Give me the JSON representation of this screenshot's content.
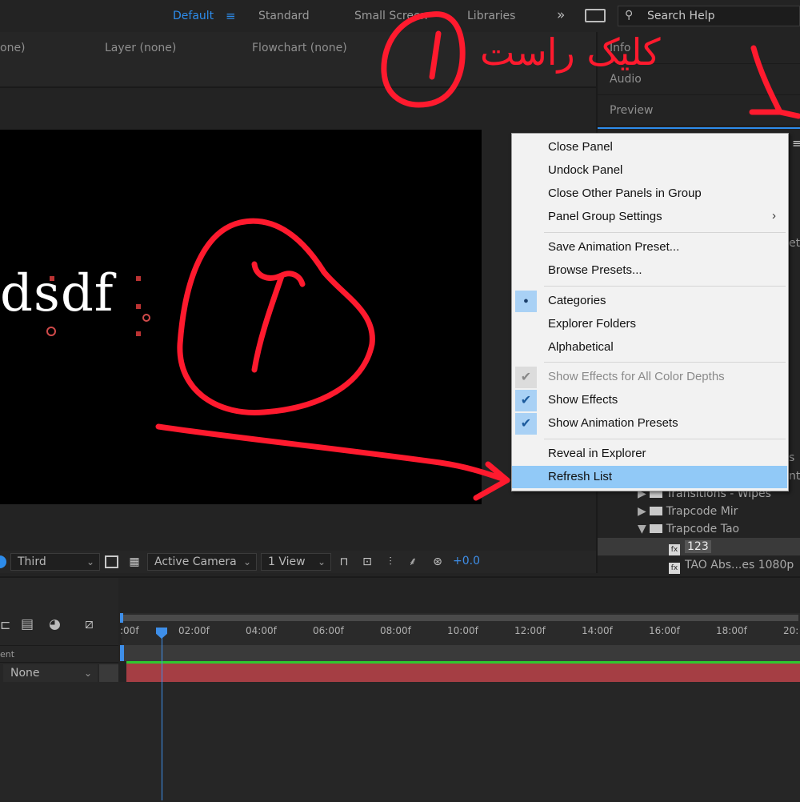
{
  "workspace": {
    "items": [
      "Default",
      "Standard",
      "Small Screen",
      "Libraries"
    ],
    "overflow": "»",
    "search_placeholder": "Search Help"
  },
  "panel_tabs": {
    "composition": "one)",
    "layer": "Layer (none)",
    "flowchart": "Flowchart (none)"
  },
  "composition": {
    "text": "dsdf"
  },
  "viewer_controls": {
    "resolution": "Third",
    "camera": "Active Camera",
    "views": "1 View",
    "exposure": "+0.0"
  },
  "right_panel": {
    "tabs": [
      "Info",
      "Audio",
      "Preview"
    ],
    "partial_texts": [
      "ets",
      "s",
      "nt"
    ],
    "tree": [
      {
        "label": "Transitions - Wipes",
        "type": "folder",
        "expanded": false
      },
      {
        "label": "Trapcode Mir",
        "type": "folder",
        "expanded": false
      },
      {
        "label": "Trapcode Tao",
        "type": "folder",
        "expanded": true
      },
      {
        "label": "123",
        "type": "preset",
        "selected": true
      },
      {
        "label": "TAO Abs...es 1080p",
        "type": "preset",
        "selected": false
      }
    ]
  },
  "context_menu": {
    "items": [
      {
        "label": "Close Panel",
        "state": "normal"
      },
      {
        "label": "Undock Panel",
        "state": "normal"
      },
      {
        "label": "Close Other Panels in Group",
        "state": "normal"
      },
      {
        "label": "Panel Group Settings",
        "state": "submenu"
      },
      {
        "label": "Save Animation Preset...",
        "state": "normal"
      },
      {
        "label": "Browse Presets...",
        "state": "normal"
      },
      {
        "label": "Categories",
        "state": "radio"
      },
      {
        "label": "Explorer Folders",
        "state": "normal"
      },
      {
        "label": "Alphabetical",
        "state": "normal"
      },
      {
        "label": "Show Effects for All Color Depths",
        "state": "disabled-checked"
      },
      {
        "label": "Show Effects",
        "state": "checked"
      },
      {
        "label": "Show Animation Presets",
        "state": "checked"
      },
      {
        "label": "Reveal in Explorer",
        "state": "normal"
      },
      {
        "label": "Refresh List",
        "state": "highlighted"
      }
    ]
  },
  "timeline": {
    "ticks": [
      ":00f",
      "02:00f",
      "04:00f",
      "06:00f",
      "08:00f",
      "10:00f",
      "12:00f",
      "14:00f",
      "16:00f",
      "18:00f",
      "20:"
    ],
    "left_label": "ent",
    "parent_value": "None"
  },
  "annotation": {
    "text": "کلیک راست",
    "step1": "1",
    "step2": "2",
    "color": "#ff1a2e"
  },
  "colors": {
    "accent": "#2d8ceb",
    "highlight": "#91c9f7",
    "layer_bar": "#a53e44"
  }
}
